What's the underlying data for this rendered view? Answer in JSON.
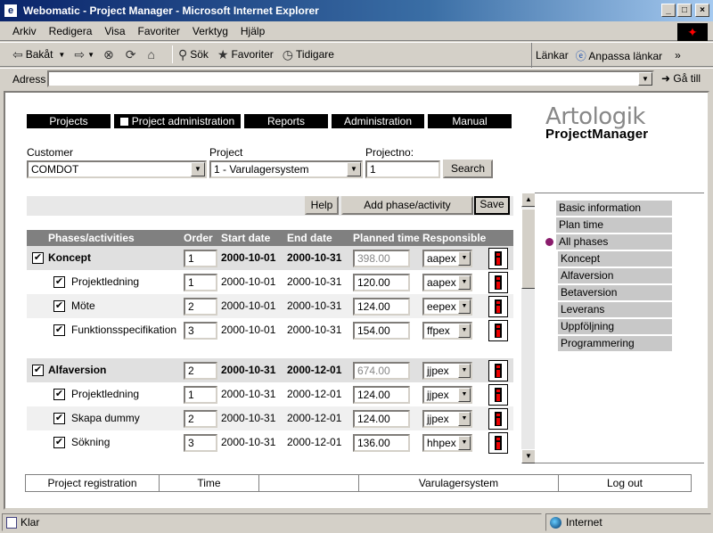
{
  "window": {
    "title": "Webomatic - Project Manager - Microsoft Internet Explorer"
  },
  "menu": [
    "Arkiv",
    "Redigera",
    "Visa",
    "Favoriter",
    "Verktyg",
    "Hjälp"
  ],
  "toolbar": {
    "back": "Bakåt",
    "search": "Sök",
    "favorites": "Favoriter",
    "history": "Tidigare",
    "links": "Länkar",
    "customize_links": "Anpassa länkar"
  },
  "address": {
    "label": "Adress",
    "value": "",
    "go": "Gå till"
  },
  "nav": [
    "Projects",
    "Project administration",
    "Reports",
    "Administration",
    "Manual"
  ],
  "brand": {
    "line1": "Artologik",
    "line2": "ProjectManager"
  },
  "filters": {
    "customer_label": "Customer",
    "customer_value": "COMDOT",
    "project_label": "Project",
    "project_value": "1 - Varulagersystem",
    "projectno_label": "Projectno:",
    "projectno_value": "1",
    "search_button": "Search"
  },
  "actions": {
    "help": "Help",
    "add": "Add phase/activity",
    "save": "Save"
  },
  "grid": {
    "headers": [
      "Phases/activities",
      "Order",
      "Start date",
      "End date",
      "Planned time",
      "Responsible"
    ],
    "rows": [
      {
        "type": "phase",
        "name": "Koncept",
        "order": "1",
        "start": "2000-10-01",
        "end": "2000-10-31",
        "planned": "398.00",
        "resp": "aapex"
      },
      {
        "type": "activity",
        "name": "Projektledning",
        "order": "1",
        "start": "2000-10-01",
        "end": "2000-10-31",
        "planned": "120.00",
        "resp": "aapex"
      },
      {
        "type": "activity",
        "name": "Möte",
        "order": "2",
        "start": "2000-10-01",
        "end": "2000-10-31",
        "planned": "124.00",
        "resp": "eepex"
      },
      {
        "type": "activity",
        "name": "Funktionsspecifikation",
        "order": "3",
        "start": "2000-10-01",
        "end": "2000-10-31",
        "planned": "154.00",
        "resp": "ffpex"
      },
      {
        "type": "phase",
        "name": "Alfaversion",
        "order": "2",
        "start": "2000-10-31",
        "end": "2000-12-01",
        "planned": "674.00",
        "resp": "jjpex"
      },
      {
        "type": "activity",
        "name": "Projektledning",
        "order": "1",
        "start": "2000-10-31",
        "end": "2000-12-01",
        "planned": "124.00",
        "resp": "jjpex"
      },
      {
        "type": "activity",
        "name": "Skapa dummy",
        "order": "2",
        "start": "2000-10-31",
        "end": "2000-12-01",
        "planned": "124.00",
        "resp": "jjpex"
      },
      {
        "type": "activity",
        "name": "Sökning",
        "order": "3",
        "start": "2000-10-31",
        "end": "2000-12-01",
        "planned": "136.00",
        "resp": "hhpex"
      }
    ]
  },
  "sidebar": [
    "Basic information",
    "Plan time",
    "All phases",
    "Koncept",
    "Alfaversion",
    "Betaversion",
    "Leverans",
    "Uppföljning",
    "Programmering"
  ],
  "footer": [
    "Project registration",
    "Time",
    "",
    "Varulagersystem",
    "Log out"
  ],
  "status": {
    "left": "Klar",
    "right": "Internet"
  }
}
